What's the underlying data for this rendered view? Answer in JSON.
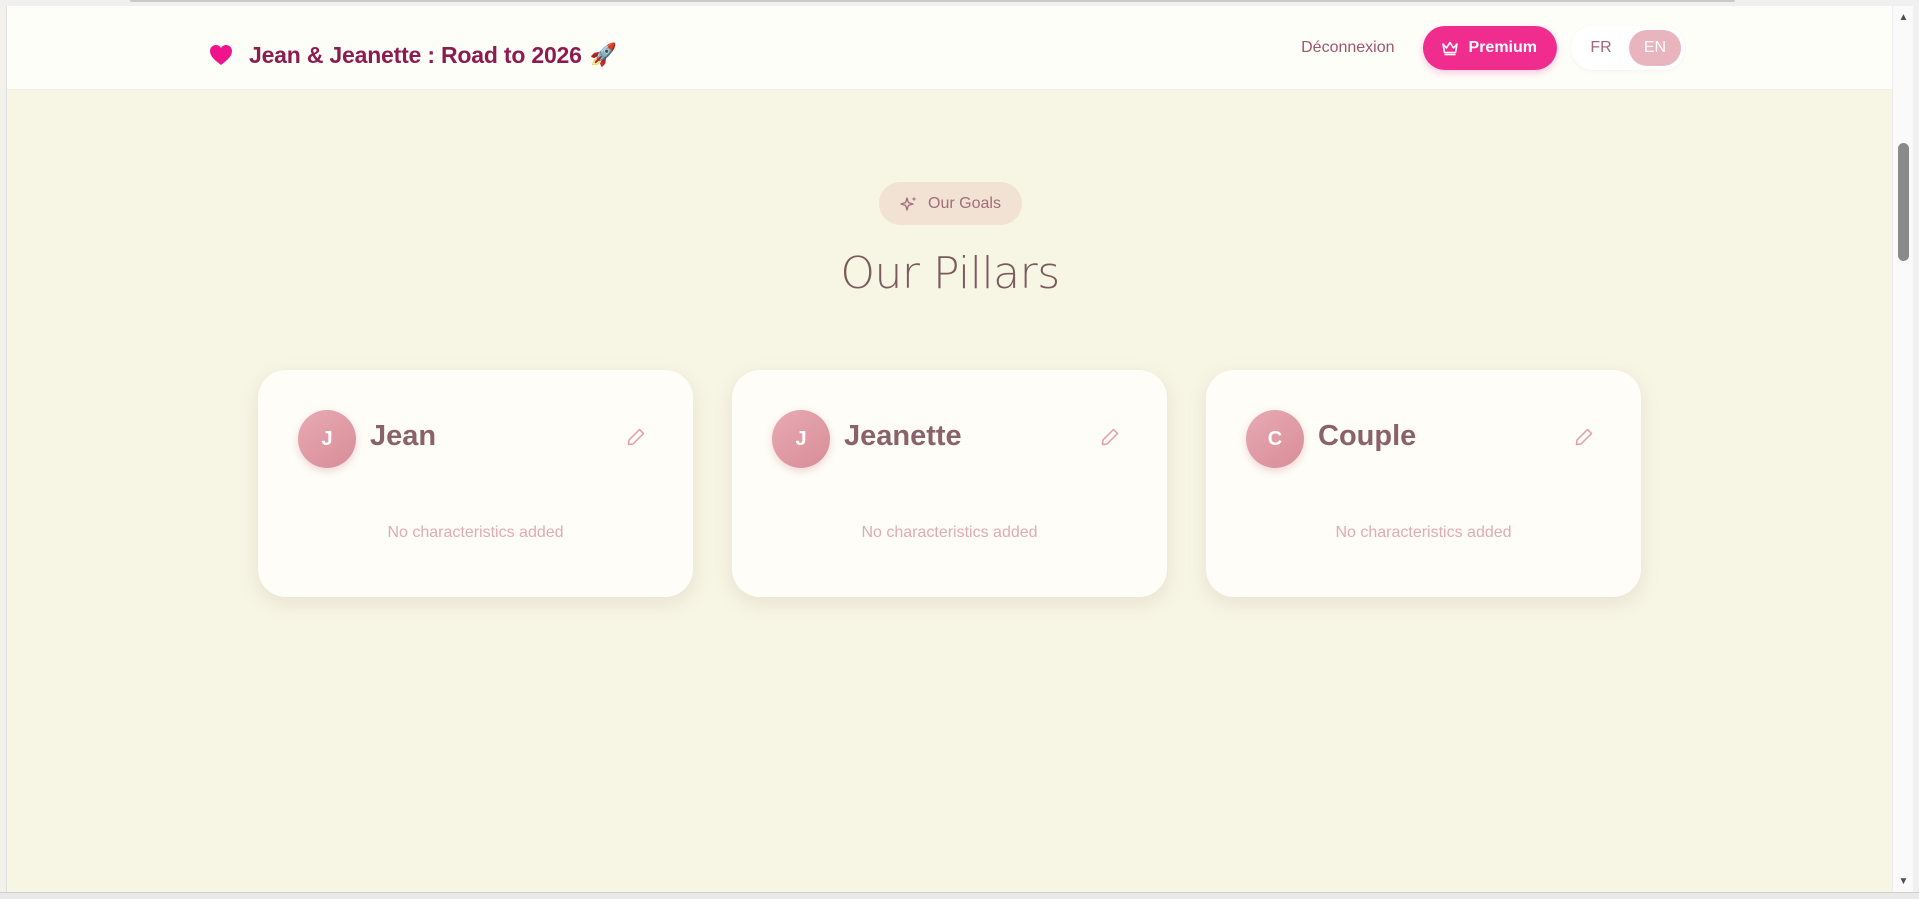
{
  "header": {
    "brand_title": "Jean & Jeanette : Road to 2026",
    "brand_emoji": "🚀",
    "logout_label": "Déconnexion",
    "premium_label": "Premium",
    "languages": [
      "FR",
      "EN"
    ],
    "active_language": "EN"
  },
  "main": {
    "badge_label": "Our Goals",
    "section_title": "Our Pillars",
    "cards": [
      {
        "initial": "J",
        "name": "Jean",
        "empty_text": "No characteristics added"
      },
      {
        "initial": "J",
        "name": "Jeanette",
        "empty_text": "No characteristics added"
      },
      {
        "initial": "C",
        "name": "Couple",
        "empty_text": "No characteristics added"
      }
    ]
  },
  "colors": {
    "brand": "#8d1c4e",
    "accent": "#f02c8e",
    "background": "#f7f5e4",
    "avatar": "#e2a0aa"
  },
  "icons": {
    "heart": "heart-icon",
    "crown": "crown-icon",
    "sparkle": "sparkle-icon",
    "edit": "pencil-icon"
  }
}
